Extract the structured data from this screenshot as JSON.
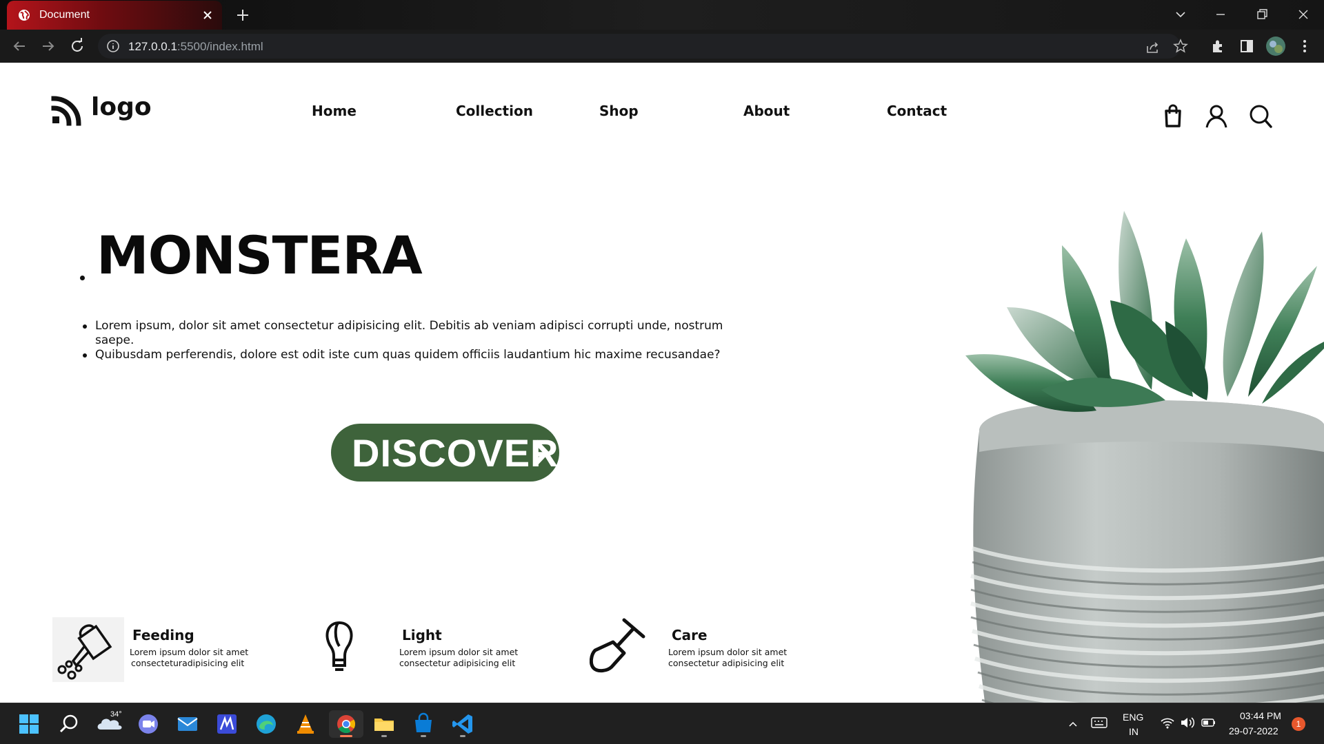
{
  "browser": {
    "tab_title": "Document",
    "url_host": "127.0.0.1",
    "url_rest": ":5500/index.html"
  },
  "site": {
    "logo_text": "logo",
    "nav": [
      "Home",
      "Collection",
      "Shop",
      "About",
      "Contact"
    ],
    "hero_title": "MONSTERA",
    "hero_points": [
      "Lorem ipsum, dolor sit amet consectetur adipisicing elit. Debitis ab veniam adipisci corrupti unde, nostrum saepe.",
      "Quibusdam perferendis, dolore est odit iste cum quas quidem officiis laudantium hic maxime recusandae?"
    ],
    "cta_label": "DISCOVER",
    "features": [
      {
        "title": "Feeding",
        "line1": "Lorem ipsum dolor sit amet",
        "line2": "consecteturadipisicing elit",
        "icon": "watering-can-icon"
      },
      {
        "title": "Light",
        "line1": "Lorem ipsum dolor sit amet",
        "line2": "consectetur adipisicing elit",
        "icon": "lightbulb-icon"
      },
      {
        "title": "Care",
        "line1": "Lorem ipsum dolor sit amet",
        "line2": "consectetur adipisicing elit",
        "icon": "shovel-icon"
      }
    ],
    "accent_color": "#3e633b"
  },
  "taskbar": {
    "weather_temp": "34°",
    "lang_top": "ENG",
    "lang_bottom": "IN",
    "time": "03:44 PM",
    "date": "29-07-2022",
    "notification_count": "1"
  }
}
